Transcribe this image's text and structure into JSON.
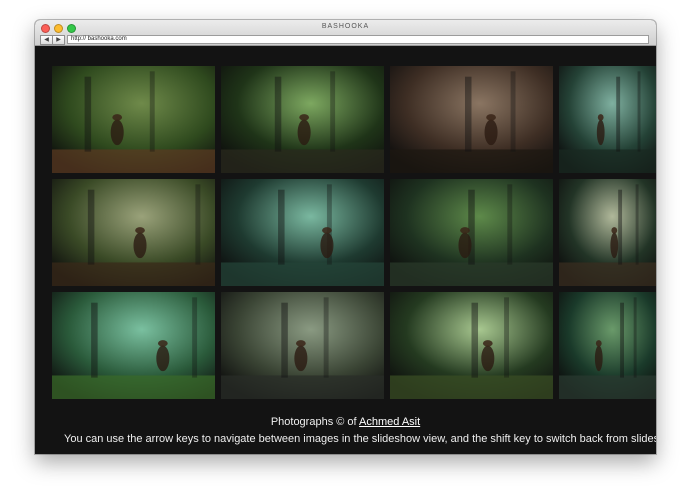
{
  "window": {
    "title": "BASHOOKA",
    "url": "http:// bashooka.com"
  },
  "toolbar": {
    "back_icon": "back-arrow-icon",
    "forward_icon": "forward-arrow-icon"
  },
  "gallery": {
    "photos": [
      {
        "desc": "boy with bird in forest",
        "colors": [
          "#2f4a1e",
          "#6f8a4a",
          "#5a3a22"
        ]
      },
      {
        "desc": "children in green forest path",
        "colors": [
          "#1f3418",
          "#7da860",
          "#2a2a1e"
        ]
      },
      {
        "desc": "man with rooster at table in smoky hut",
        "colors": [
          "#3e2e24",
          "#8a7562",
          "#1e1812"
        ]
      },
      {
        "desc": "figures by misty forest stream",
        "colors": [
          "#244236",
          "#7fb0a0",
          "#1a2a22"
        ]
      },
      {
        "desc": "children splashing in river",
        "colors": [
          "#3a4a26",
          "#9aa27a",
          "#3a2a1a"
        ]
      },
      {
        "desc": "women walking in green water",
        "colors": [
          "#1e3a30",
          "#7ab8a0",
          "#244438"
        ]
      },
      {
        "desc": "girl in red by jungle pool",
        "colors": [
          "#1e3220",
          "#5e8a4a",
          "#2a3a2a"
        ]
      },
      {
        "desc": "child with umbrella in forest",
        "colors": [
          "#223426",
          "#b0b89a",
          "#3a2e20"
        ]
      },
      {
        "desc": "boys fencing in bright forest",
        "colors": [
          "#2a5a3a",
          "#7ac0a0",
          "#3a6a2a"
        ]
      },
      {
        "desc": "girl on misty tree road",
        "colors": [
          "#3a4434",
          "#8a9a82",
          "#2a2e28"
        ]
      },
      {
        "desc": "boy playing music in field",
        "colors": [
          "#243a20",
          "#a8c890",
          "#3a4e24"
        ]
      },
      {
        "desc": "boy in green forest stream",
        "colors": [
          "#1a3a2a",
          "#6a9a6a",
          "#2a3a30"
        ]
      }
    ]
  },
  "footer": {
    "credit_prefix": "Photographs © of ",
    "credit_link": "Achmed Asit",
    "instructions": "You can use the arrow keys to navigate between images in the slideshow view, and the shift key to switch back from slideshow"
  }
}
